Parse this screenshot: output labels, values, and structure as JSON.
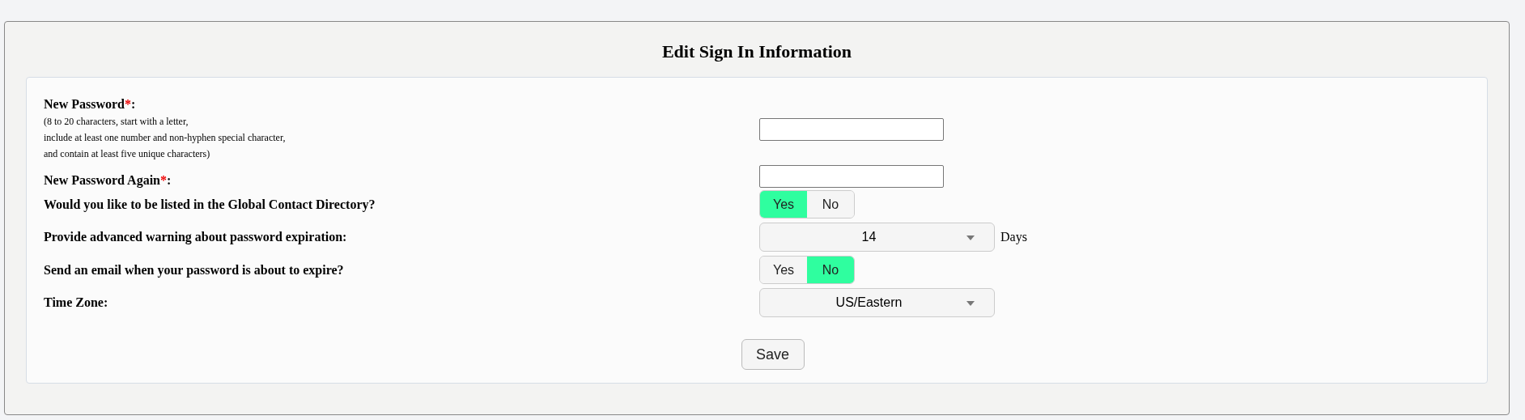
{
  "title": "Edit Sign In Information",
  "fields": [
    {
      "kind": "password",
      "label": "New Password",
      "required_mark": "*",
      "label_end": ":",
      "hint": [
        "(8 to 20 characters, start with a letter,",
        "include at least one number and non-hyphen special character,",
        "and contain at least five unique characters)"
      ]
    },
    {
      "kind": "password",
      "label": "New Password Again",
      "required_mark": "*",
      "label_end": ":"
    },
    {
      "kind": "toggle",
      "label": "Would you like to be listed in the Global Contact Directory?",
      "options": [
        {
          "label": "Yes",
          "selected": true
        },
        {
          "label": "No",
          "selected": false
        }
      ]
    },
    {
      "kind": "select",
      "label": "Provide advanced warning about password expiration:",
      "value": "14",
      "suffix": "Days"
    },
    {
      "kind": "toggle",
      "label": "Send an email when your password is about to expire?",
      "options": [
        {
          "label": "Yes",
          "selected": false
        },
        {
          "label": "No",
          "selected": true
        }
      ]
    },
    {
      "kind": "select",
      "label": "Time Zone:",
      "value": "US/Eastern"
    }
  ],
  "save_button": "Save"
}
